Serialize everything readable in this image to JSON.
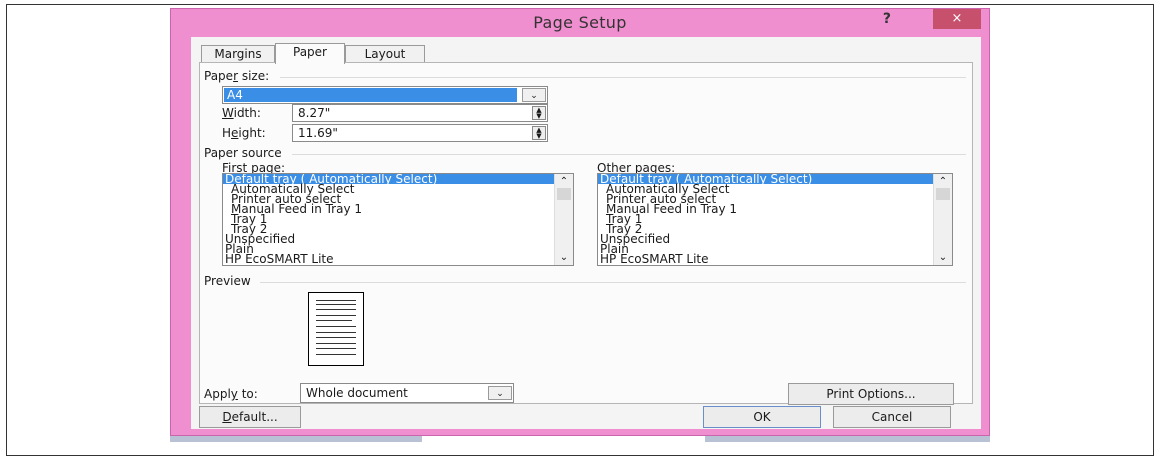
{
  "window": {
    "title": "Page Setup",
    "help_label": "?",
    "close_label": "×"
  },
  "tabs": [
    {
      "label": "Margins",
      "active": false
    },
    {
      "label": "Paper",
      "active": true
    },
    {
      "label": "Layout",
      "active": false
    }
  ],
  "paper_size": {
    "group_label_pre": "Pape",
    "group_label_u": "r",
    "group_label_post": " size:",
    "selected": "A4",
    "width_label_u": "W",
    "width_label_post": "idth:",
    "width_value": "8.27\"",
    "height_label_pre": "H",
    "height_label_u": "e",
    "height_label_post": "ight:",
    "height_value": "11.69\""
  },
  "paper_source": {
    "group_label": "Paper source",
    "first_page_label_u": "F",
    "first_page_label_post": "irst page:",
    "other_pages_label_u": "O",
    "other_pages_label_post": "ther pages:",
    "first_items": [
      "Default tray ( Automatically Select)",
      "Automatically Select",
      "Printer auto select",
      "Manual Feed in Tray 1",
      "Tray 1",
      "Tray 2",
      "Unspecified",
      "Plain",
      "HP EcoSMART Lite"
    ],
    "other_items": [
      "Default tray ( Automatically Select)",
      "Automatically Select",
      "Printer auto select",
      "Manual Feed in Tray 1",
      "Tray 1",
      "Tray 2",
      "Unspecified",
      "Plain",
      "HP EcoSMART Lite"
    ]
  },
  "preview": {
    "group_label": "Preview"
  },
  "apply_to": {
    "label_pre": "Appl",
    "label_u": "y",
    "label_post": " to:",
    "value": "Whole document"
  },
  "buttons": {
    "print_options": "Print Options...",
    "default_u": "D",
    "default_post": "efault...",
    "ok": "OK",
    "cancel": "Cancel"
  },
  "colors": {
    "window_frame": "#f08fcf",
    "selection": "#3a8ee6",
    "close_button": "#c7506d"
  }
}
